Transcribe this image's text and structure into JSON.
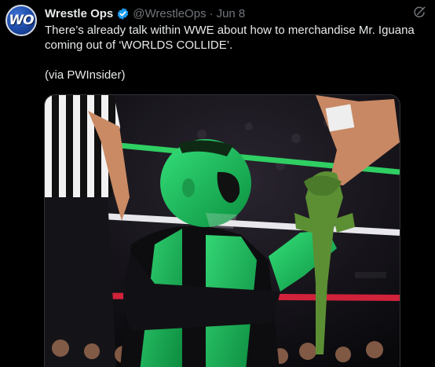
{
  "tweet": {
    "avatar_text": "WO",
    "display_name": "Wrestle Ops",
    "handle": "@WrestleOps",
    "separator": "·",
    "date": "Jun 8",
    "text_line1": "There’s already talk within WWE about how to merchandise Mr. Iguana coming out of ‘WORLDS COLLIDE’.",
    "text_line2": "(via PWInsider)"
  },
  "icons": {
    "verified": "verified-badge-icon",
    "grok": "grok-icon"
  },
  "colors": {
    "background": "#000000",
    "text": "#e7e9ea",
    "muted": "#71767b",
    "verified": "#1d9bf0"
  }
}
